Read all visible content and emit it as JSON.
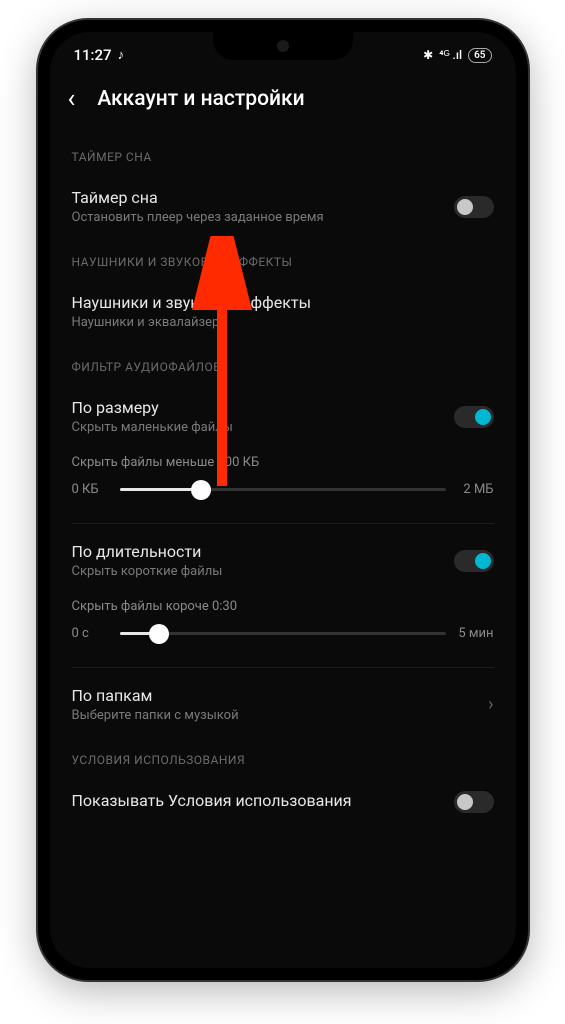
{
  "status": {
    "time": "11:27",
    "music_icon": "♪",
    "bluetooth_icon": "✱",
    "signal": "⁴ᴳ .ıl",
    "battery": "65"
  },
  "header": {
    "back_icon": "‹",
    "title": "Аккаунт и настройки"
  },
  "sections": {
    "sleep_timer": {
      "label": "ТАЙМЕР СНА",
      "item": {
        "title": "Таймер сна",
        "sub": "Остановить плеер через заданное время",
        "on": false
      }
    },
    "headphones": {
      "label": "НАУШНИКИ И ЗВУКОВЫЕ ЭФФЕКТЫ",
      "item": {
        "title": "Наушники и звуковые эффекты",
        "sub": "Наушники и эквалайзер"
      }
    },
    "filter": {
      "label": "ФИЛЬТР АУДИОФАЙЛОВ",
      "by_size": {
        "title": "По размеру",
        "sub": "Скрыть маленькие файлы",
        "on": true,
        "slider_label": "Скрыть файлы меньше 500 КБ",
        "min": "0 КБ",
        "max": "2 МБ",
        "pct": 25
      },
      "by_duration": {
        "title": "По длительности",
        "sub": "Скрыть короткие файлы",
        "on": true,
        "slider_label": "Скрыть файлы короче 0:30",
        "min": "0 с",
        "max": "5 мин",
        "pct": 12
      },
      "by_folder": {
        "title": "По папкам",
        "sub": "Выберите папки с музыкой"
      }
    },
    "terms": {
      "label": "УСЛОВИЯ ИСПОЛЬЗОВАНИЯ",
      "item": {
        "title": "Показывать Условия использования"
      }
    }
  }
}
